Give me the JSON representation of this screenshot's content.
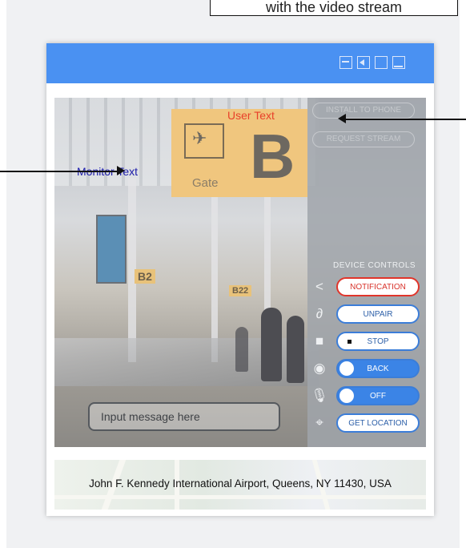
{
  "callout": {
    "text": "with the video stream"
  },
  "window": {
    "icons": [
      "minimize-icon",
      "mute-icon",
      "maximize-icon",
      "dock-icon"
    ],
    "accent_color": "#4a91f2"
  },
  "stream": {
    "gate_word": "Gate",
    "gate_letter": "B",
    "overlays": {
      "monitor_text": "Monitor Text",
      "user_text": "User Text"
    },
    "signs": [
      "B2",
      "B22"
    ],
    "input": {
      "placeholder": "Input message here"
    }
  },
  "side_panel": {
    "top_buttons": [
      "INSTALL TO PHONE",
      "REQUEST STREAM"
    ],
    "device_controls_title": "DEVICE CONTROLS",
    "controls": [
      {
        "icon": "share-icon",
        "label": "NOTIFICATION"
      },
      {
        "icon": "link-icon",
        "label": "UNPAIR"
      },
      {
        "icon": "video-camera-icon",
        "label": "STOP"
      },
      {
        "icon": "eye-icon",
        "label": "BACK"
      },
      {
        "icon": "microphone-icon",
        "label": "OFF"
      },
      {
        "icon": "location-icon",
        "label": "GET LOCATION"
      }
    ]
  },
  "footer": {
    "address": "John F. Kennedy International Airport, Queens, NY 11430, USA"
  }
}
